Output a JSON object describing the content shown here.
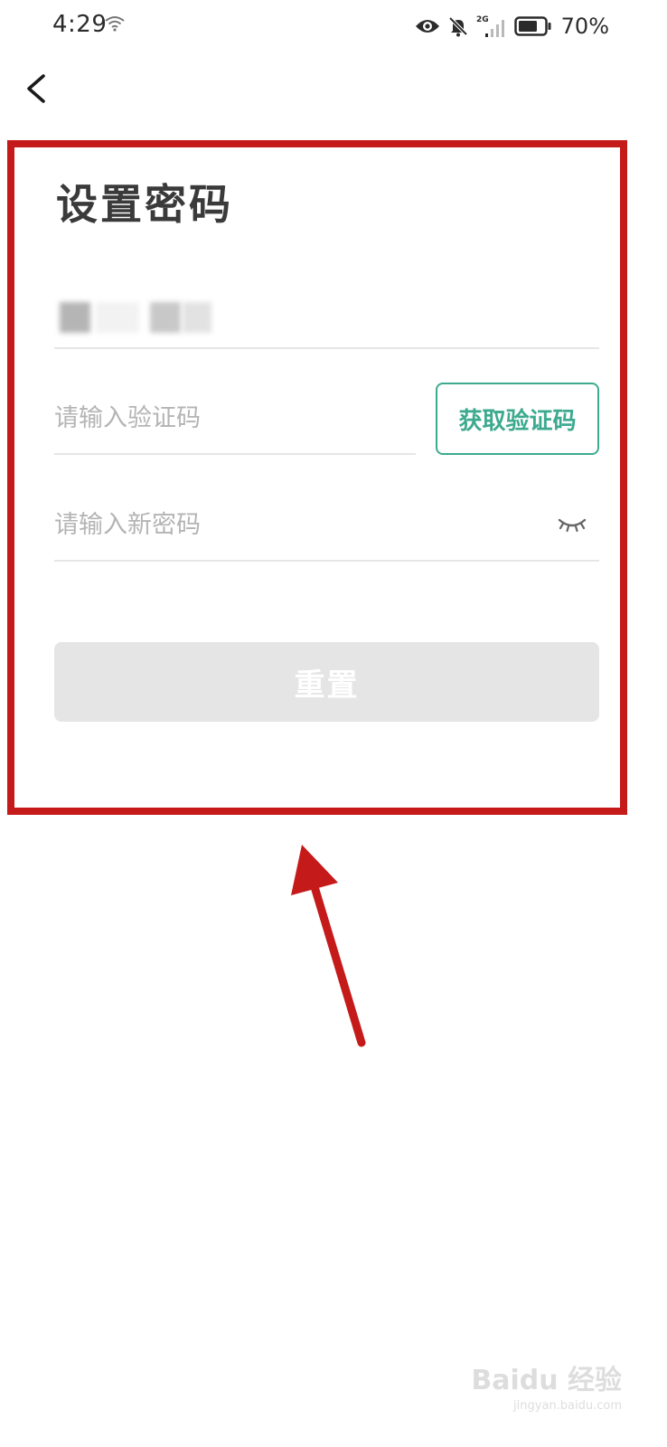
{
  "status_bar": {
    "time": "4:29",
    "network": "2G",
    "battery": "70%"
  },
  "page": {
    "title": "设置密码"
  },
  "form": {
    "code_placeholder": "请输入验证码",
    "get_code_label": "获取验证码",
    "password_placeholder": "请输入新密码",
    "reset_label": "重置"
  },
  "watermark": {
    "brand": "Baidu 经验",
    "url": "jingyan.baidu.com"
  },
  "colors": {
    "accent_green": "#3daa8f",
    "annotation_red": "#c51a1a",
    "button_disabled": "#e5e5e5",
    "placeholder": "#b4b4b4",
    "divider": "#e6e6e6"
  },
  "icons": [
    "wifi-icon",
    "eye-icon",
    "bell-muted-icon",
    "signal-icon",
    "battery-icon",
    "back-arrow-icon",
    "eye-closed-icon"
  ]
}
